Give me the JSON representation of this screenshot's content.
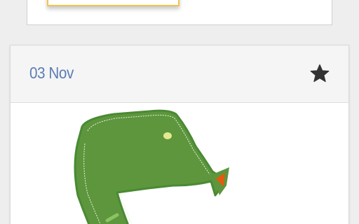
{
  "entry": {
    "date": "03 Nov"
  },
  "icons": {
    "favorite": "star-icon",
    "artwork": "green-drawing-icon"
  },
  "colors": {
    "date_text": "#5b7db4",
    "header_bg": "#f5f5f5",
    "star": "#333333",
    "drawing_fill": "#5d963d",
    "drawing_outline": "#4a8a33",
    "accent_orange": "#e25b10",
    "thumb_border": "#f2c44d"
  }
}
